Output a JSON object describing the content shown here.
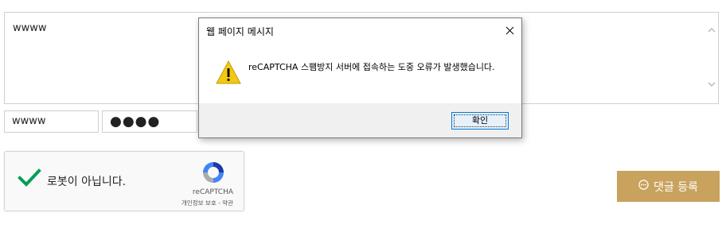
{
  "comment": {
    "content": "wwww"
  },
  "form": {
    "name_value": "wwww",
    "password_value": "●●●●"
  },
  "recaptcha": {
    "label": "로봇이 아닙니다.",
    "brand": "reCAPTCHA",
    "terms": "개인정보 보호 - 약관",
    "check_color": "#009e55"
  },
  "submit": {
    "label": "댓글 등록",
    "icon": "speech-bubble-icon",
    "color": "#c9a25e"
  },
  "dialog": {
    "title": "웹 페이지 메시지",
    "message": "reCAPTCHA 스팸방지 서버에 접속하는 도중 오류가 발생했습니다.",
    "ok_label": "확인",
    "icon": "warning-icon"
  }
}
